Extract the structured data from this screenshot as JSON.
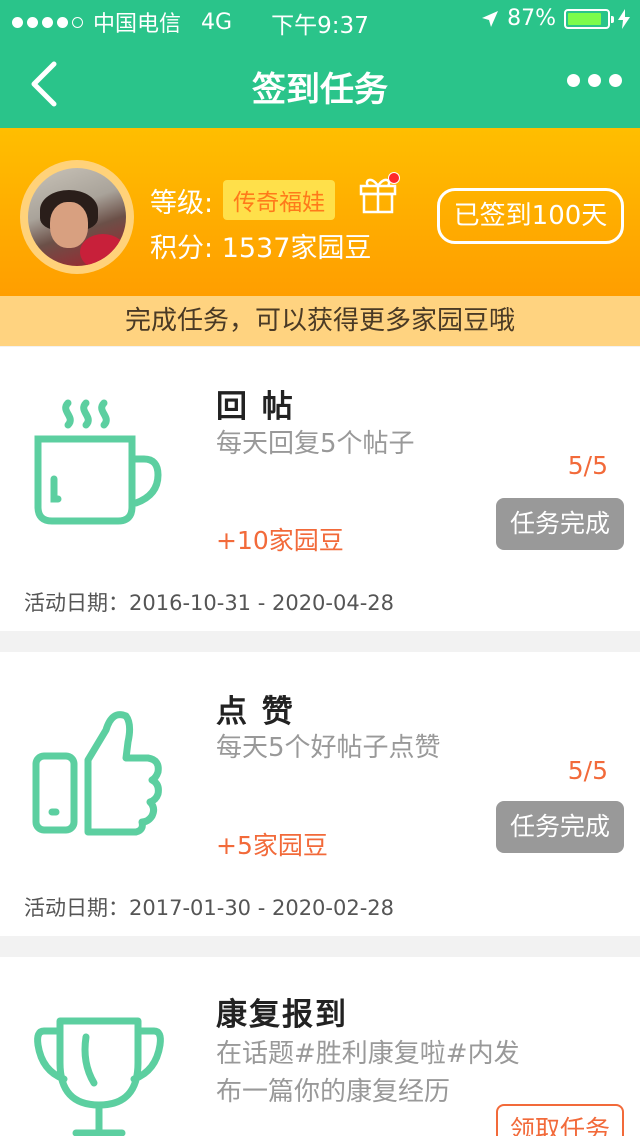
{
  "status_bar": {
    "carrier": "中国电信",
    "network": "4G",
    "time": "下午9:37",
    "battery": "87%",
    "battery_level": 0.87
  },
  "nav": {
    "title": "签到任务"
  },
  "profile": {
    "level_label": "等级:",
    "level_value": "传奇福娃",
    "points_label": "积分:",
    "points_value": "1537家园豆",
    "checkin_status": "已签到100天"
  },
  "banner": "完成任务，可以获得更多家园豆哦",
  "tasks": [
    {
      "name": "回 帖",
      "desc": "每天回复5个帖子",
      "progress": "5/5",
      "reward": "+10家园豆",
      "button": "任务完成",
      "date": "活动日期：2016-10-31 - 2020-04-28",
      "icon": "coffee-cup-icon"
    },
    {
      "name": "点 赞",
      "desc": "每天5个好帖子点赞",
      "progress": "5/5",
      "reward": "+5家园豆",
      "button": "任务完成",
      "date": "活动日期：2017-01-30 - 2020-02-28",
      "icon": "thumbs-up-icon"
    },
    {
      "name": "康复报到",
      "desc_line1": "在话题#胜利康复啦#内发",
      "desc_line2": "布一篇你的康复经历",
      "button": "领取任务",
      "icon": "trophy-icon"
    }
  ],
  "colors": {
    "brand_green": "#2ac48a",
    "header_orange": "#ffaa00",
    "accent_orange": "#f26a3a",
    "icon_green": "#5ccfa0"
  }
}
